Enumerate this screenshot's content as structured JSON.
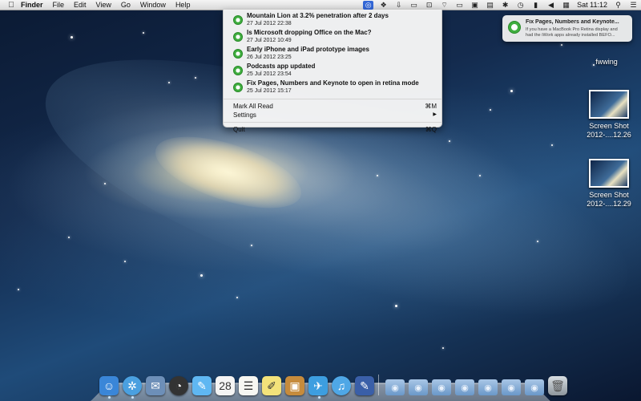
{
  "menubar": {
    "apple_icon": "apple-icon",
    "app_name": "Finder",
    "menus": [
      "File",
      "Edit",
      "View",
      "Go",
      "Window",
      "Help"
    ],
    "status_icons": [
      {
        "name": "rss-reader-icon",
        "glyph": "◎"
      },
      {
        "name": "dropbox-icon",
        "glyph": "❖"
      },
      {
        "name": "download-icon",
        "glyph": "⇩"
      },
      {
        "name": "menu-extra-icon",
        "glyph": "▭"
      },
      {
        "name": "crop-icon",
        "glyph": "⊡"
      },
      {
        "name": "wifi-icon",
        "glyph": "⌔"
      },
      {
        "name": "airplay-icon",
        "glyph": "▭"
      },
      {
        "name": "display-icon",
        "glyph": "▣"
      },
      {
        "name": "mirror-icon",
        "glyph": "▤"
      },
      {
        "name": "bluetooth-icon",
        "glyph": "✱"
      },
      {
        "name": "time-machine-icon",
        "glyph": "◷"
      },
      {
        "name": "battery-icon",
        "glyph": "▮"
      },
      {
        "name": "volume-icon",
        "glyph": "◀"
      },
      {
        "name": "keyboard-icon",
        "glyph": "▦"
      }
    ],
    "clock": "Sat 11:12"
  },
  "dropdown": {
    "items": [
      {
        "title": "Mountain Lion at 3.2% penetration after 2 days",
        "date": "27 Jul 2012 22:38"
      },
      {
        "title": "Is Microsoft dropping Office on the Mac?",
        "date": "27 Jul 2012 10:49"
      },
      {
        "title": "Early iPhone and iPad prototype images",
        "date": "26 Jul 2012 23:25"
      },
      {
        "title": "Podcasts app updated",
        "date": "25 Jul 2012 23:54"
      },
      {
        "title": "Fix Pages, Numbers and Keynote to open in retina mode",
        "date": "25 Jul 2012 15:17"
      }
    ],
    "mark_all_read": "Mark All Read",
    "mark_all_read_shortcut": "⌘M",
    "settings": "Settings",
    "settings_arrow": "▶",
    "quit": "Quit",
    "quit_shortcut": "⌘Q"
  },
  "notification": {
    "title": "Fix Pages, Numbers and Keynote...",
    "body_line1": "If you have a MacBook Pro Retina display and",
    "body_line2": "had the iWork apps already installed BEFO..."
  },
  "desktop": {
    "items": [
      {
        "label": "fwwing"
      },
      {
        "label_line1": "Screen Shot",
        "label_line2": "2012-....12.26"
      },
      {
        "label_line1": "Screen Shot",
        "label_line2": "2012-....12.29"
      }
    ]
  },
  "dock": {
    "apps": [
      {
        "name": "finder",
        "glyph": "☺",
        "color": "#3a86d8"
      },
      {
        "name": "safari",
        "glyph": "✲",
        "color": "#4aa0e0"
      },
      {
        "name": "mail",
        "glyph": "✉",
        "color": "#6d8fb8"
      },
      {
        "name": "dashboard",
        "glyph": "◔",
        "color": "#333333"
      },
      {
        "name": "messages",
        "glyph": "✎",
        "color": "#5fb7f2"
      },
      {
        "name": "calendar",
        "glyph": "28",
        "color": "#f4f4f4"
      },
      {
        "name": "reminders",
        "glyph": "☰",
        "color": "#f7f7f2"
      },
      {
        "name": "notes",
        "glyph": "✐",
        "color": "#f3e27a"
      },
      {
        "name": "app-store-box",
        "glyph": "▣",
        "color": "#c68b3c"
      },
      {
        "name": "twitter",
        "glyph": "✈",
        "color": "#3d9ee0"
      },
      {
        "name": "itunes",
        "glyph": "♫",
        "color": "#4fa7e6"
      },
      {
        "name": "xcode",
        "glyph": "✎",
        "color": "#3a5fa8"
      }
    ],
    "stacks": [
      "applications",
      "downloads",
      "documents",
      "pictures",
      "music",
      "developer",
      "preview"
    ],
    "trash": "trash"
  }
}
